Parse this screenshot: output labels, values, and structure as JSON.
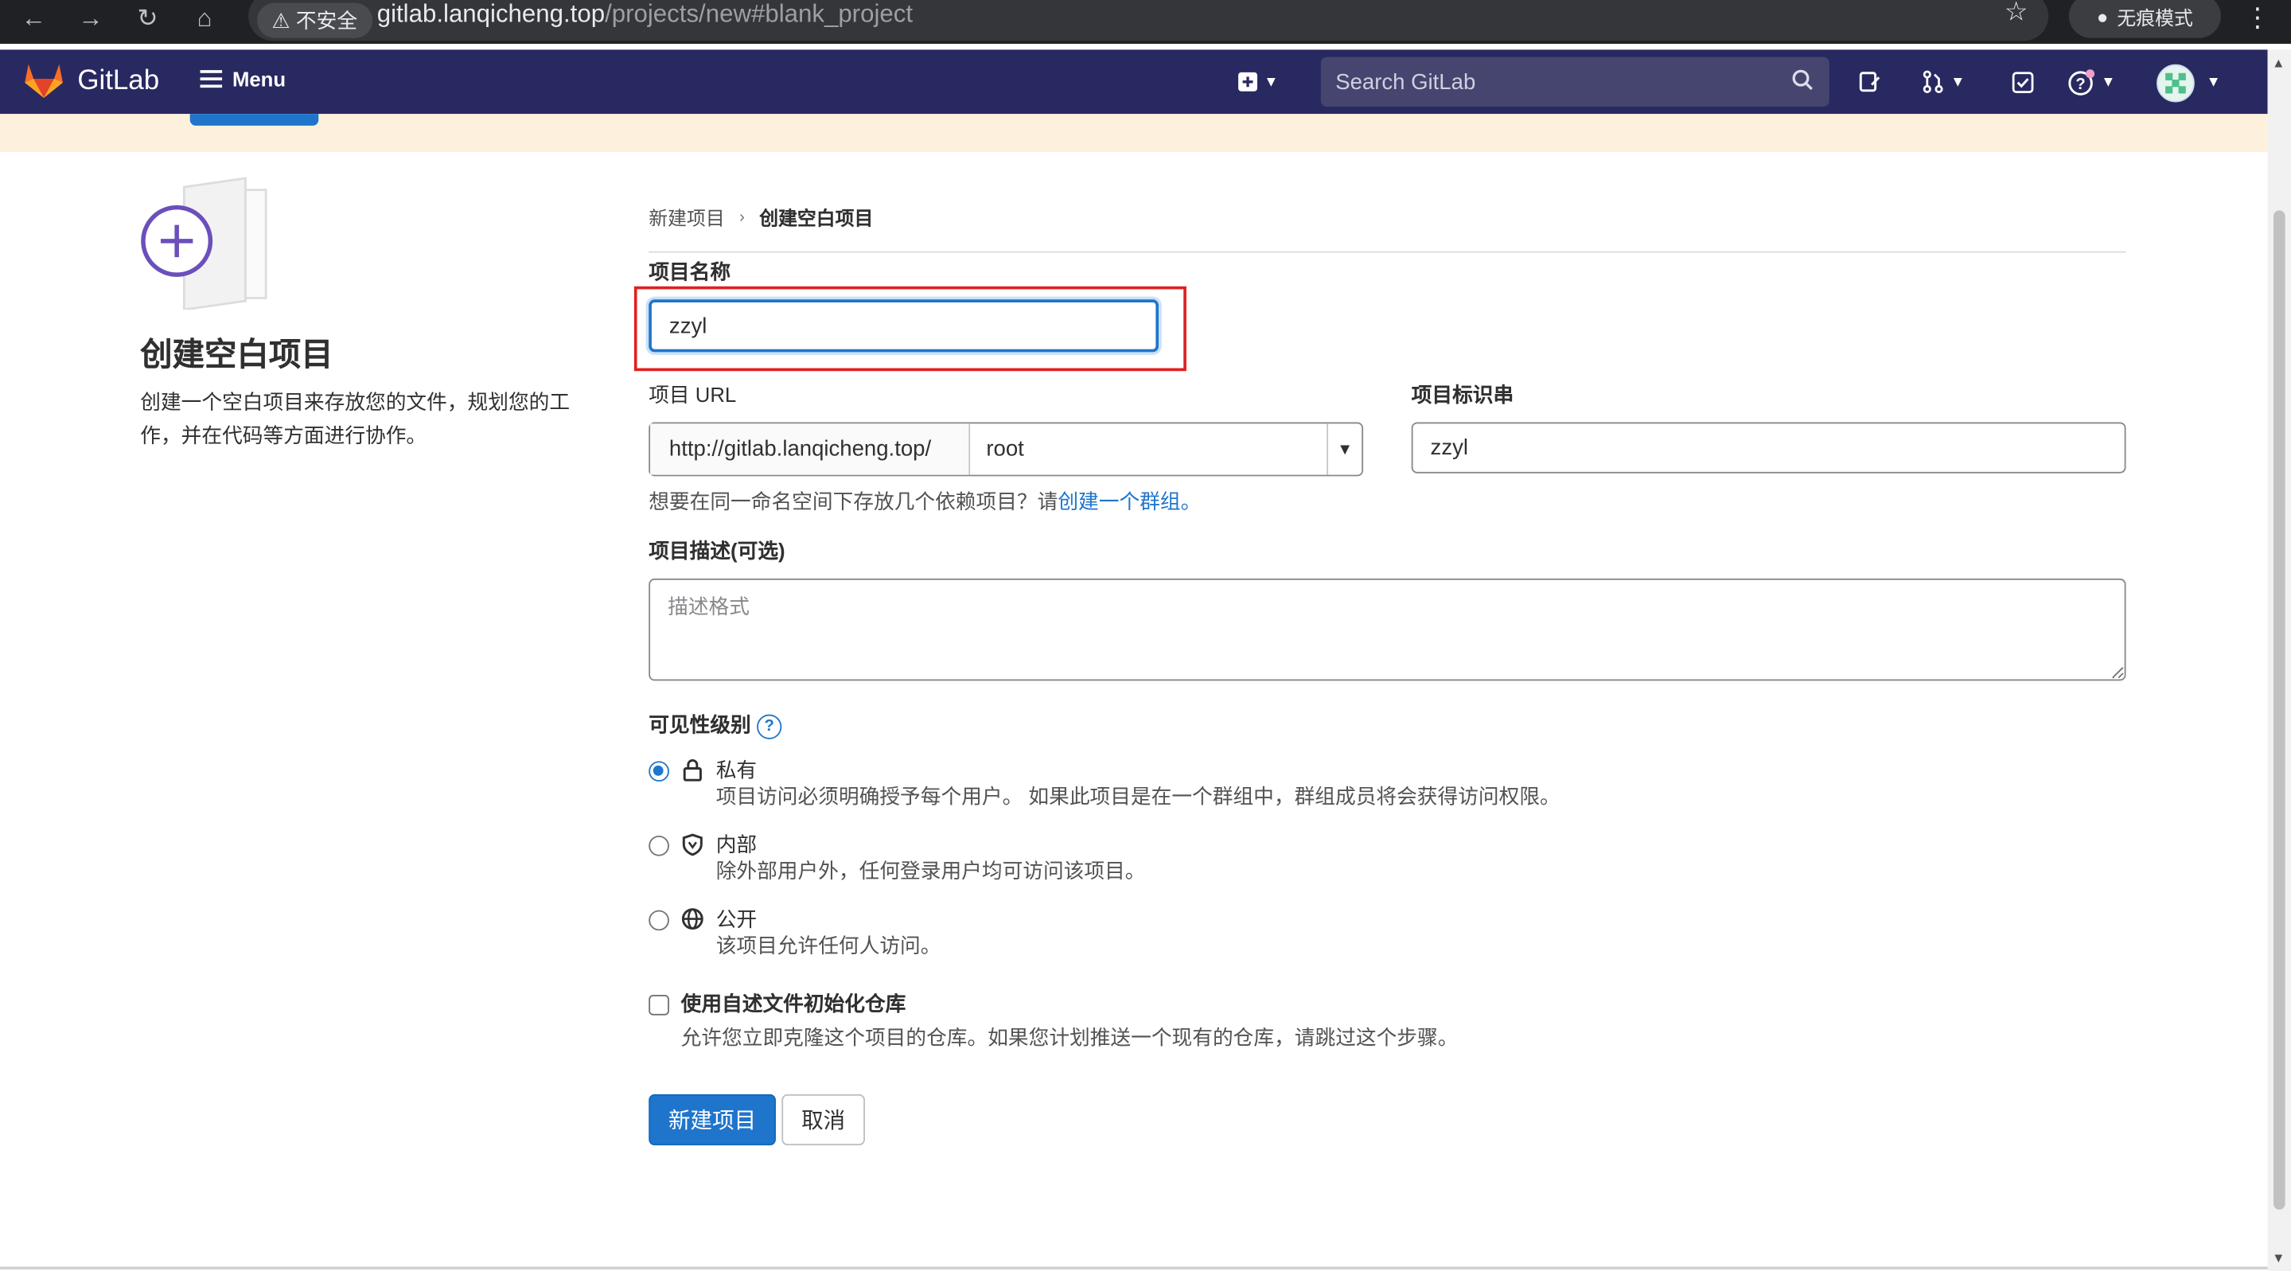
{
  "browser": {
    "insecure_label": "不安全",
    "url_host": "gitlab.lanqicheng.top",
    "url_path": "/projects/new#blank_project",
    "incognito_label": "无痕模式"
  },
  "header": {
    "brand": "GitLab",
    "menu_label": "Menu",
    "search_placeholder": "Search GitLab"
  },
  "colors": {
    "header_bg": "#292961",
    "accent": "#1f75cb",
    "banner_bg": "#fdf1dd",
    "highlight_border": "#e02020"
  },
  "left_panel": {
    "title": "创建空白项目",
    "description": "创建一个空白项目来存放您的文件，规划您的工作，并在代码等方面进行协作。"
  },
  "breadcrumb": {
    "parent": "新建项目",
    "current": "创建空白项目"
  },
  "form": {
    "name_label": "项目名称",
    "name_value": "zzyl",
    "url_label": "项目 URL",
    "url_prefix": "http://gitlab.lanqicheng.top/",
    "namespace_value": "root",
    "slug_label": "项目标识串",
    "slug_value": "zzyl",
    "help_prefix": "想要在同一命名空间下存放几个依赖项目？请",
    "help_link": "创建一个群组。",
    "description_label": "项目描述(可选)",
    "description_placeholder": "描述格式",
    "visibility_label": "可见性级别",
    "visibility_help_glyph": "?",
    "visibility_options": [
      {
        "title": "私有",
        "desc": "项目访问必须明确授予每个用户。 如果此项目是在一个群组中，群组成员将会获得访问权限。",
        "checked": true,
        "icon": "lock-icon"
      },
      {
        "title": "内部",
        "desc": "除外部用户外，任何登录用户均可访问该项目。",
        "checked": false,
        "icon": "shield-icon"
      },
      {
        "title": "公开",
        "desc": "该项目允许任何人访问。",
        "checked": false,
        "icon": "globe-icon"
      }
    ],
    "readme_label": "使用自述文件初始化仓库",
    "readme_desc": "允许您立即克隆这个项目的仓库。如果您计划推送一个现有的仓库，请跳过这个步骤。",
    "readme_checked": false,
    "submit_label": "新建项目",
    "cancel_label": "取消"
  }
}
